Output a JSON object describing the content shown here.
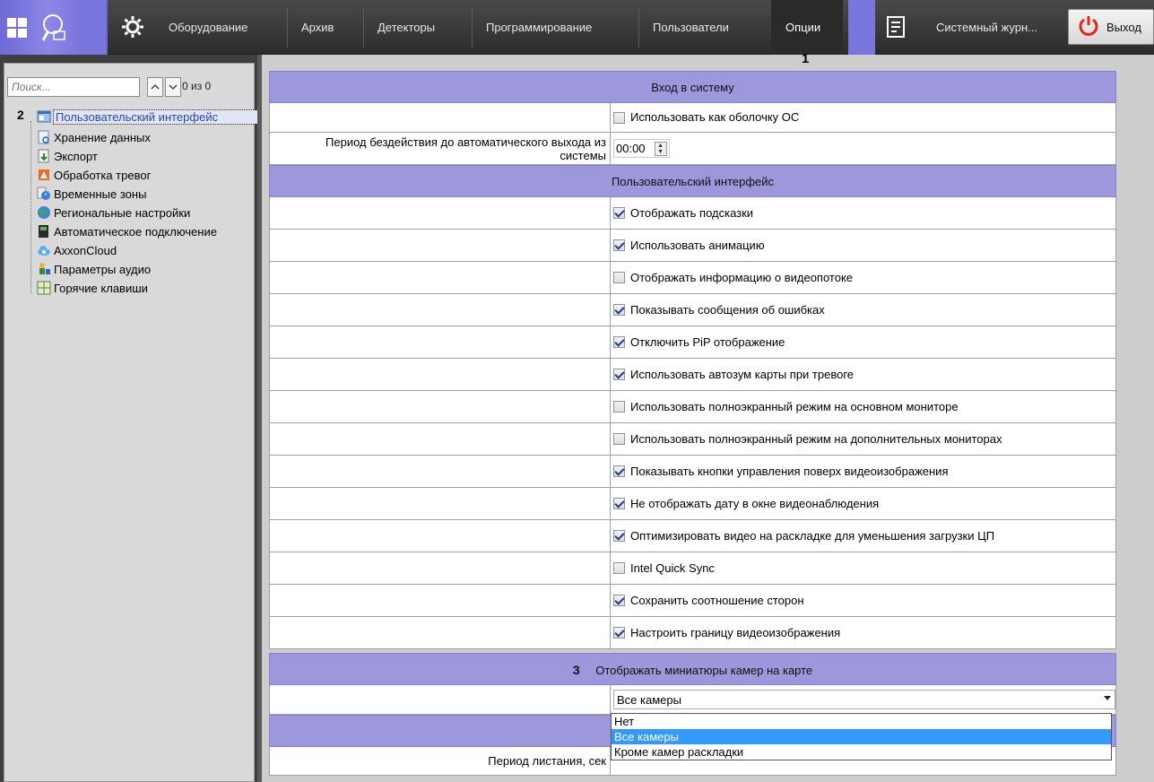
{
  "topbar": {
    "items": [
      {
        "label": "Оборудование"
      },
      {
        "label": "Архив"
      },
      {
        "label": "Детекторы"
      },
      {
        "label": "Программирование"
      },
      {
        "label": "Пользователи"
      },
      {
        "label": "Опции",
        "active": true
      },
      {
        "label": "Системный журн..."
      }
    ],
    "exit_label": "Выход",
    "marker": "1"
  },
  "sidebar": {
    "search_placeholder": "Поиск...",
    "counter": "0 из 0",
    "marker": "2",
    "items": [
      {
        "label": "Пользовательский интерфейс",
        "icon": "ui-icon",
        "selected": true
      },
      {
        "label": "Хранение данных",
        "icon": "storage-icon"
      },
      {
        "label": "Экспорт",
        "icon": "export-icon"
      },
      {
        "label": "Обработка тревог",
        "icon": "alarm-icon"
      },
      {
        "label": "Временные зоны",
        "icon": "timezone-icon"
      },
      {
        "label": "Региональные настройки",
        "icon": "globe-icon"
      },
      {
        "label": "Автоматическое подключение",
        "icon": "autoconnect-icon"
      },
      {
        "label": "AxxonCloud",
        "icon": "cloud-icon"
      },
      {
        "label": "Параметры аудио",
        "icon": "audio-icon"
      },
      {
        "label": "Горячие клавиши",
        "icon": "hotkeys-icon"
      }
    ]
  },
  "settings": {
    "login_section": "Вход в систему",
    "use_as_shell": {
      "label": "Использовать как оболочку ОС",
      "checked": false
    },
    "idle_period_label": "Период бездействия до автоматического выхода из системы",
    "idle_period_value": "00:00",
    "ui_section": "Пользовательский интерфейс",
    "ui_options": [
      {
        "label": "Отображать подсказки",
        "checked": true
      },
      {
        "label": "Использовать анимацию",
        "checked": true
      },
      {
        "label": "Отображать информацию о видеопотоке",
        "checked": false
      },
      {
        "label": "Показывать сообщения об ошибках",
        "checked": true
      },
      {
        "label": "Отключить PiP отображение",
        "checked": true
      },
      {
        "label": "Использовать автозум карты при тревоге",
        "checked": true
      },
      {
        "label": "Использовать полноэкранный режим на основном мониторе",
        "checked": false
      },
      {
        "label": "Использовать полноэкранный режим на дополнительных мониторах",
        "checked": false
      },
      {
        "label": "Показывать кнопки управления поверх видеоизображения",
        "checked": true
      },
      {
        "label": "Не отображать дату в окне видеонаблюдения",
        "checked": true
      },
      {
        "label": "Оптимизировать видео на раскладке для уменьшения загрузки ЦП",
        "checked": true
      },
      {
        "label": "Intel Quick Sync",
        "checked": false
      },
      {
        "label": "Сохранить соотношение сторон",
        "checked": true
      },
      {
        "label": "Настроить границу видеоизображения",
        "checked": true
      }
    ],
    "map_section_marker": "3",
    "map_section": "Отображать миниатюры камер на карте",
    "map_select_value": "Все камеры",
    "map_select_options": [
      "Нет",
      "Все камеры",
      "Кроме камер раскладки"
    ],
    "map_select_highlighted": "Все камеры",
    "paging_label": "Период листания, сек"
  }
}
